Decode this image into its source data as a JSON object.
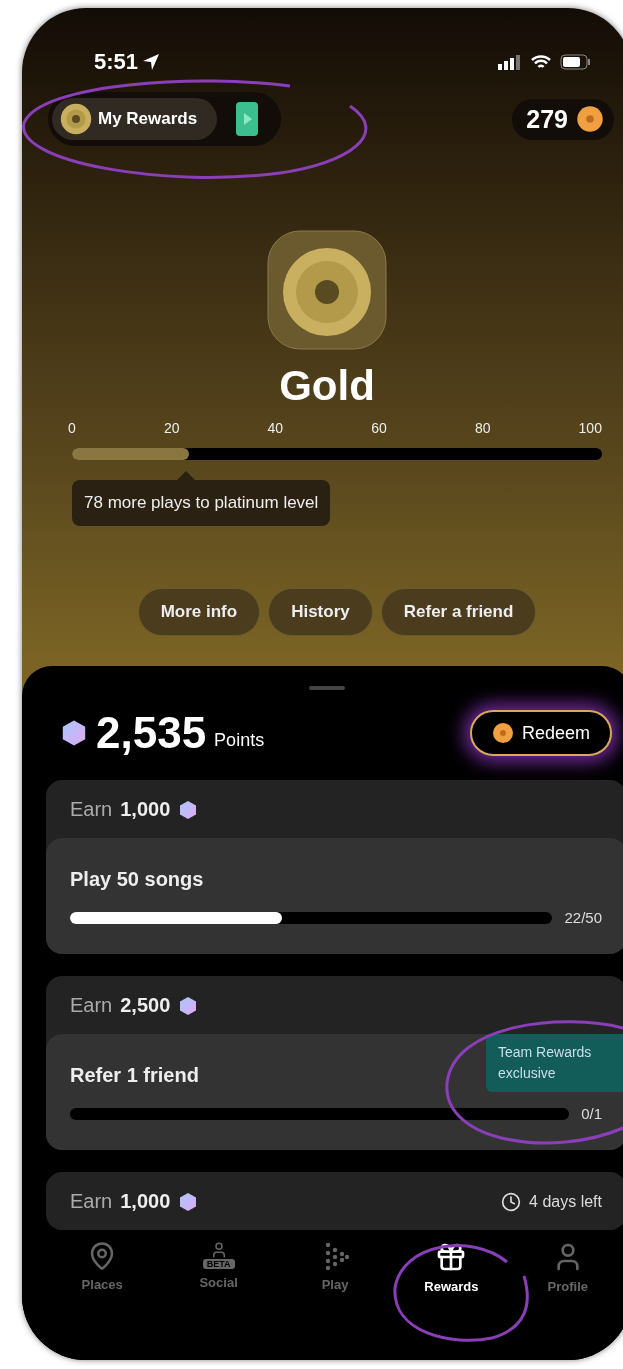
{
  "status_bar": {
    "time": "5:51"
  },
  "header": {
    "rewards_label": "My Rewards",
    "coins": "279"
  },
  "tier": {
    "name": "Gold",
    "ticks": [
      "0",
      "20",
      "40",
      "60",
      "80",
      "100"
    ],
    "level": 0.22,
    "tooltip": "78 more plays to platinum level"
  },
  "actions": [
    "More info",
    "History",
    "Refer a friend"
  ],
  "points": {
    "value": "2,535",
    "unit": "Points",
    "redeem": "Redeem"
  },
  "challenges": [
    {
      "earn": "Earn",
      "amount": "1,000",
      "title": "Play 50 songs",
      "level": 0.44,
      "progress": "22/50"
    },
    {
      "earn": "Earn",
      "amount": "2,500",
      "title": "Refer 1 friend",
      "progress": "0/1",
      "badge": "Team Rewards exclusive"
    },
    {
      "earn": "Earn",
      "amount": "1,000",
      "time_left": "4 days left"
    }
  ],
  "nav": [
    {
      "kind": "places",
      "label": "Places",
      "selected": false
    },
    {
      "kind": "social",
      "label": "Social",
      "badge": "BETA",
      "selected": false
    },
    {
      "kind": "play",
      "label": "Play",
      "selected": false
    },
    {
      "kind": "rewards",
      "label": "Rewards",
      "selected": true
    },
    {
      "kind": "profile",
      "label": "Profile",
      "selected": false
    }
  ]
}
